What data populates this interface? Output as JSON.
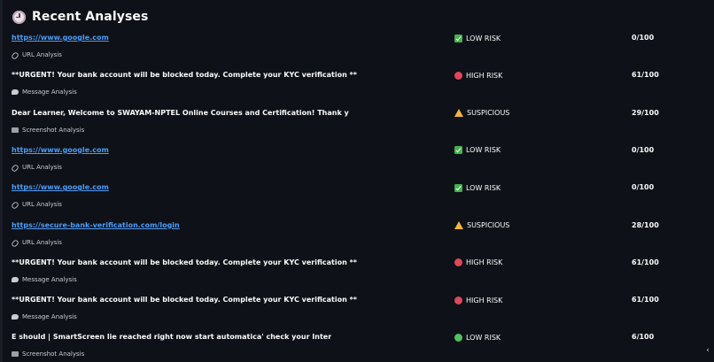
{
  "header": {
    "title": "Recent Analyses",
    "icon": "clock-icon"
  },
  "rows": [
    {
      "main": "https://www.google.com",
      "kind": "url",
      "sub": "URL Analysis",
      "sub_icon": "link-icon",
      "risk": "LOW RISK",
      "risk_icon": "check-badge",
      "score": "0/100"
    },
    {
      "main": "**URGENT! Your bank account will be blocked today. Complete your KYC verification **",
      "kind": "text",
      "sub": "Message Analysis",
      "sub_icon": "speech-bubble-icon",
      "risk": "HIGH RISK",
      "risk_icon": "red-circle",
      "score": "61/100"
    },
    {
      "main": "Dear Learner, Welcome to SWAYAM-NPTEL Online Courses and Certification! Thank y",
      "kind": "text",
      "sub": "Screenshot Analysis",
      "sub_icon": "screenshot-icon",
      "risk": "SUSPICIOUS",
      "risk_icon": "warning-triangle",
      "score": "29/100"
    },
    {
      "main": "https://www.google.com",
      "kind": "url",
      "sub": "URL Analysis",
      "sub_icon": "link-icon",
      "risk": "LOW RISK",
      "risk_icon": "check-badge",
      "score": "0/100"
    },
    {
      "main": "https://www.google.com",
      "kind": "url",
      "sub": "URL Analysis",
      "sub_icon": "link-icon",
      "risk": "LOW RISK",
      "risk_icon": "check-badge",
      "score": "0/100"
    },
    {
      "main": "https://secure-bank-verification.com/login",
      "kind": "url",
      "sub": "URL Analysis",
      "sub_icon": "link-icon",
      "risk": "SUSPICIOUS",
      "risk_icon": "warning-triangle",
      "score": "28/100"
    },
    {
      "main": "**URGENT! Your bank account will be blocked today. Complete your KYC verification **",
      "kind": "text",
      "sub": "Message Analysis",
      "sub_icon": "speech-bubble-icon",
      "risk": "HIGH RISK",
      "risk_icon": "red-circle",
      "score": "61/100"
    },
    {
      "main": "**URGENT! Your bank account will be blocked today. Complete your KYC verification **",
      "kind": "text",
      "sub": "Message Analysis",
      "sub_icon": "speech-bubble-icon",
      "risk": "HIGH RISK",
      "risk_icon": "red-circle",
      "score": "61/100"
    },
    {
      "main": "E should | SmartScreen lie reached right now start automatica' check your Inter",
      "kind": "text",
      "sub": "Screenshot Analysis",
      "sub_icon": "screenshot-icon",
      "risk": "LOW RISK",
      "risk_icon": "green-circle",
      "score": "6/100"
    }
  ],
  "colors": {
    "background": "#0e1117",
    "link": "#4a9df8",
    "low": "#43b34f",
    "high": "#e0465c",
    "suspicious": "#f2b533"
  }
}
